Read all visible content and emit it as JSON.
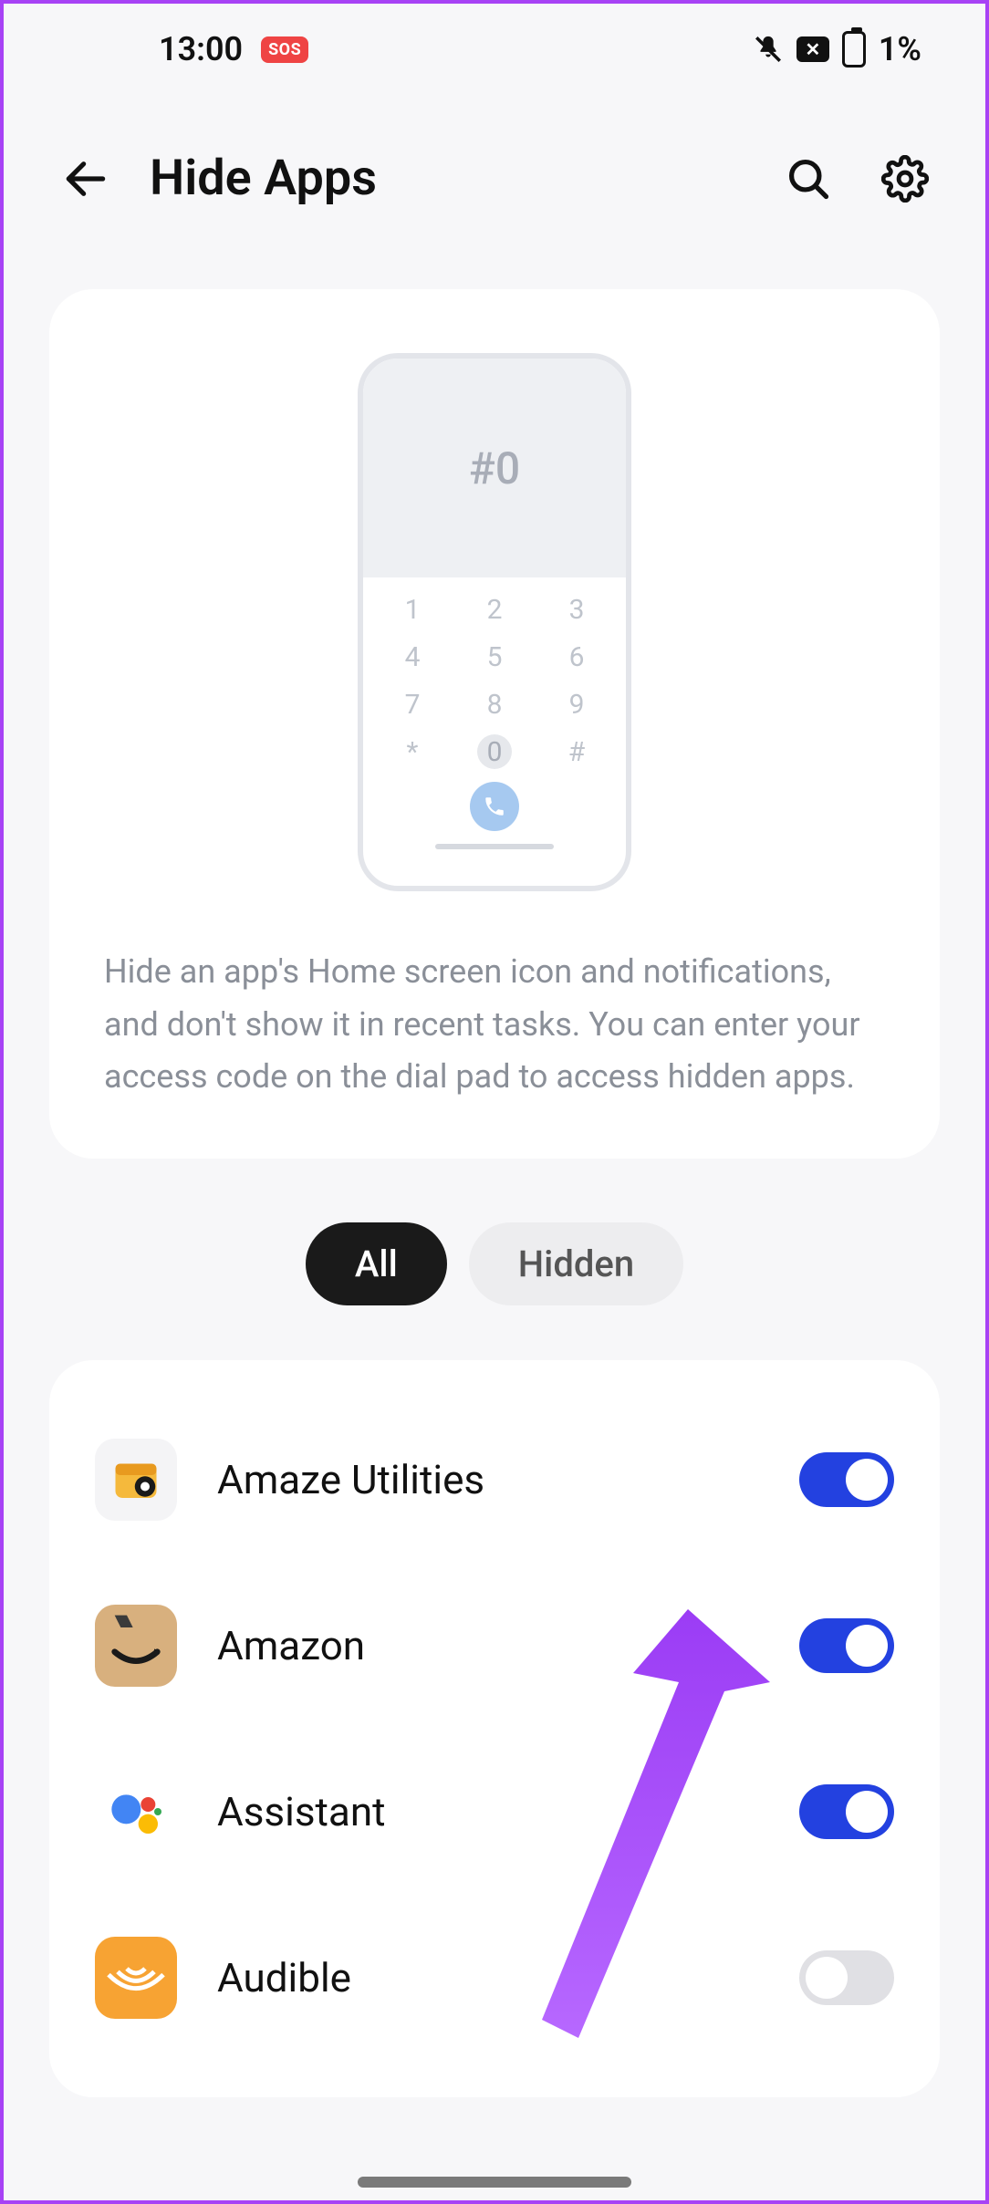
{
  "status": {
    "time": "13:00",
    "sos": "SOS",
    "battery_pct": "1%"
  },
  "header": {
    "title": "Hide Apps"
  },
  "illustration": {
    "code": "#0",
    "keys": [
      "1",
      "2",
      "3",
      "4",
      "5",
      "6",
      "7",
      "8",
      "9",
      "*",
      "0",
      "#"
    ]
  },
  "info_text": "Hide an app's Home screen icon and notifications, and don't show it in recent tasks. You can enter your access code on the dial pad to access hidden apps.",
  "tabs": {
    "all": "All",
    "hidden": "Hidden"
  },
  "apps": [
    {
      "name": "Amaze Utilities",
      "toggled": true,
      "icon": "amaze"
    },
    {
      "name": "Amazon",
      "toggled": true,
      "icon": "amazon"
    },
    {
      "name": "Assistant",
      "toggled": true,
      "icon": "assistant"
    },
    {
      "name": "Audible",
      "toggled": false,
      "icon": "audible"
    }
  ]
}
